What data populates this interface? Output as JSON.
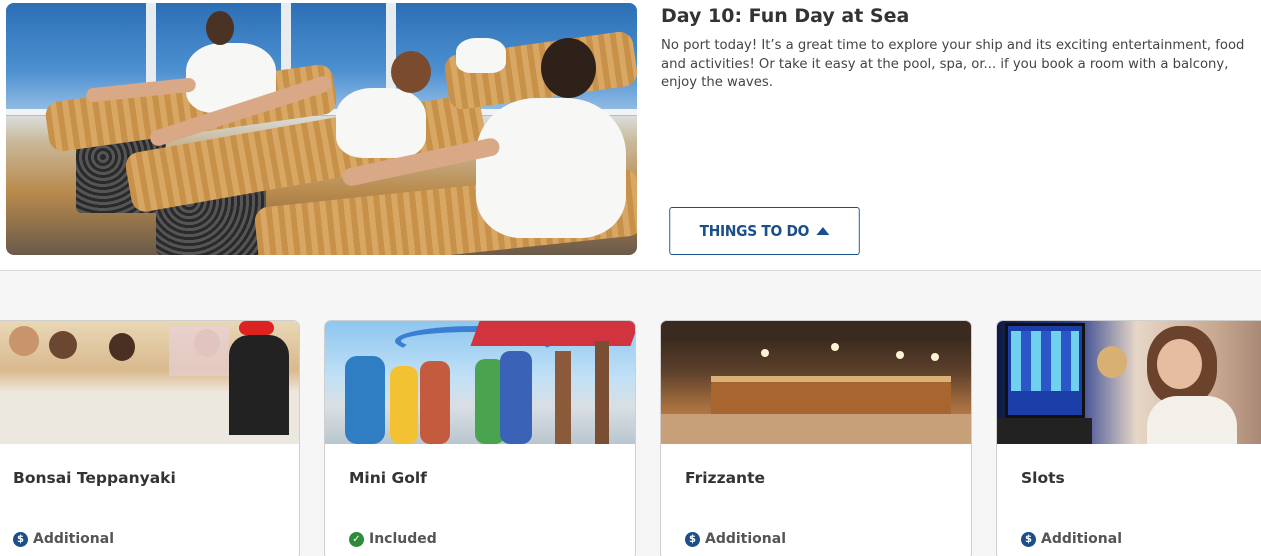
{
  "day": {
    "title": "Day 10: Fun Day at Sea",
    "description": "No port today! It’s a great time to explore your ship and its exciting entertainment, food and activities! Or take it easy at the pool, spa, or... if you book a room with a balcony, enjoy the waves.",
    "button_label": "THINGS TO DO",
    "button_icon": "caret-up-icon"
  },
  "cards": [
    {
      "title": "Bonsai Teppanyaki",
      "badge": "Additional",
      "badge_icon": "dollar-icon"
    },
    {
      "title": "Mini Golf",
      "badge": "Included",
      "badge_icon": "check-icon"
    },
    {
      "title": "Frizzante",
      "badge": "Additional",
      "badge_icon": "dollar-icon"
    },
    {
      "title": "Slots",
      "badge": "Additional",
      "badge_icon": "dollar-icon"
    }
  ],
  "colors": {
    "brand_blue": "#1a4f8b",
    "included_green": "#2e8b3a"
  }
}
